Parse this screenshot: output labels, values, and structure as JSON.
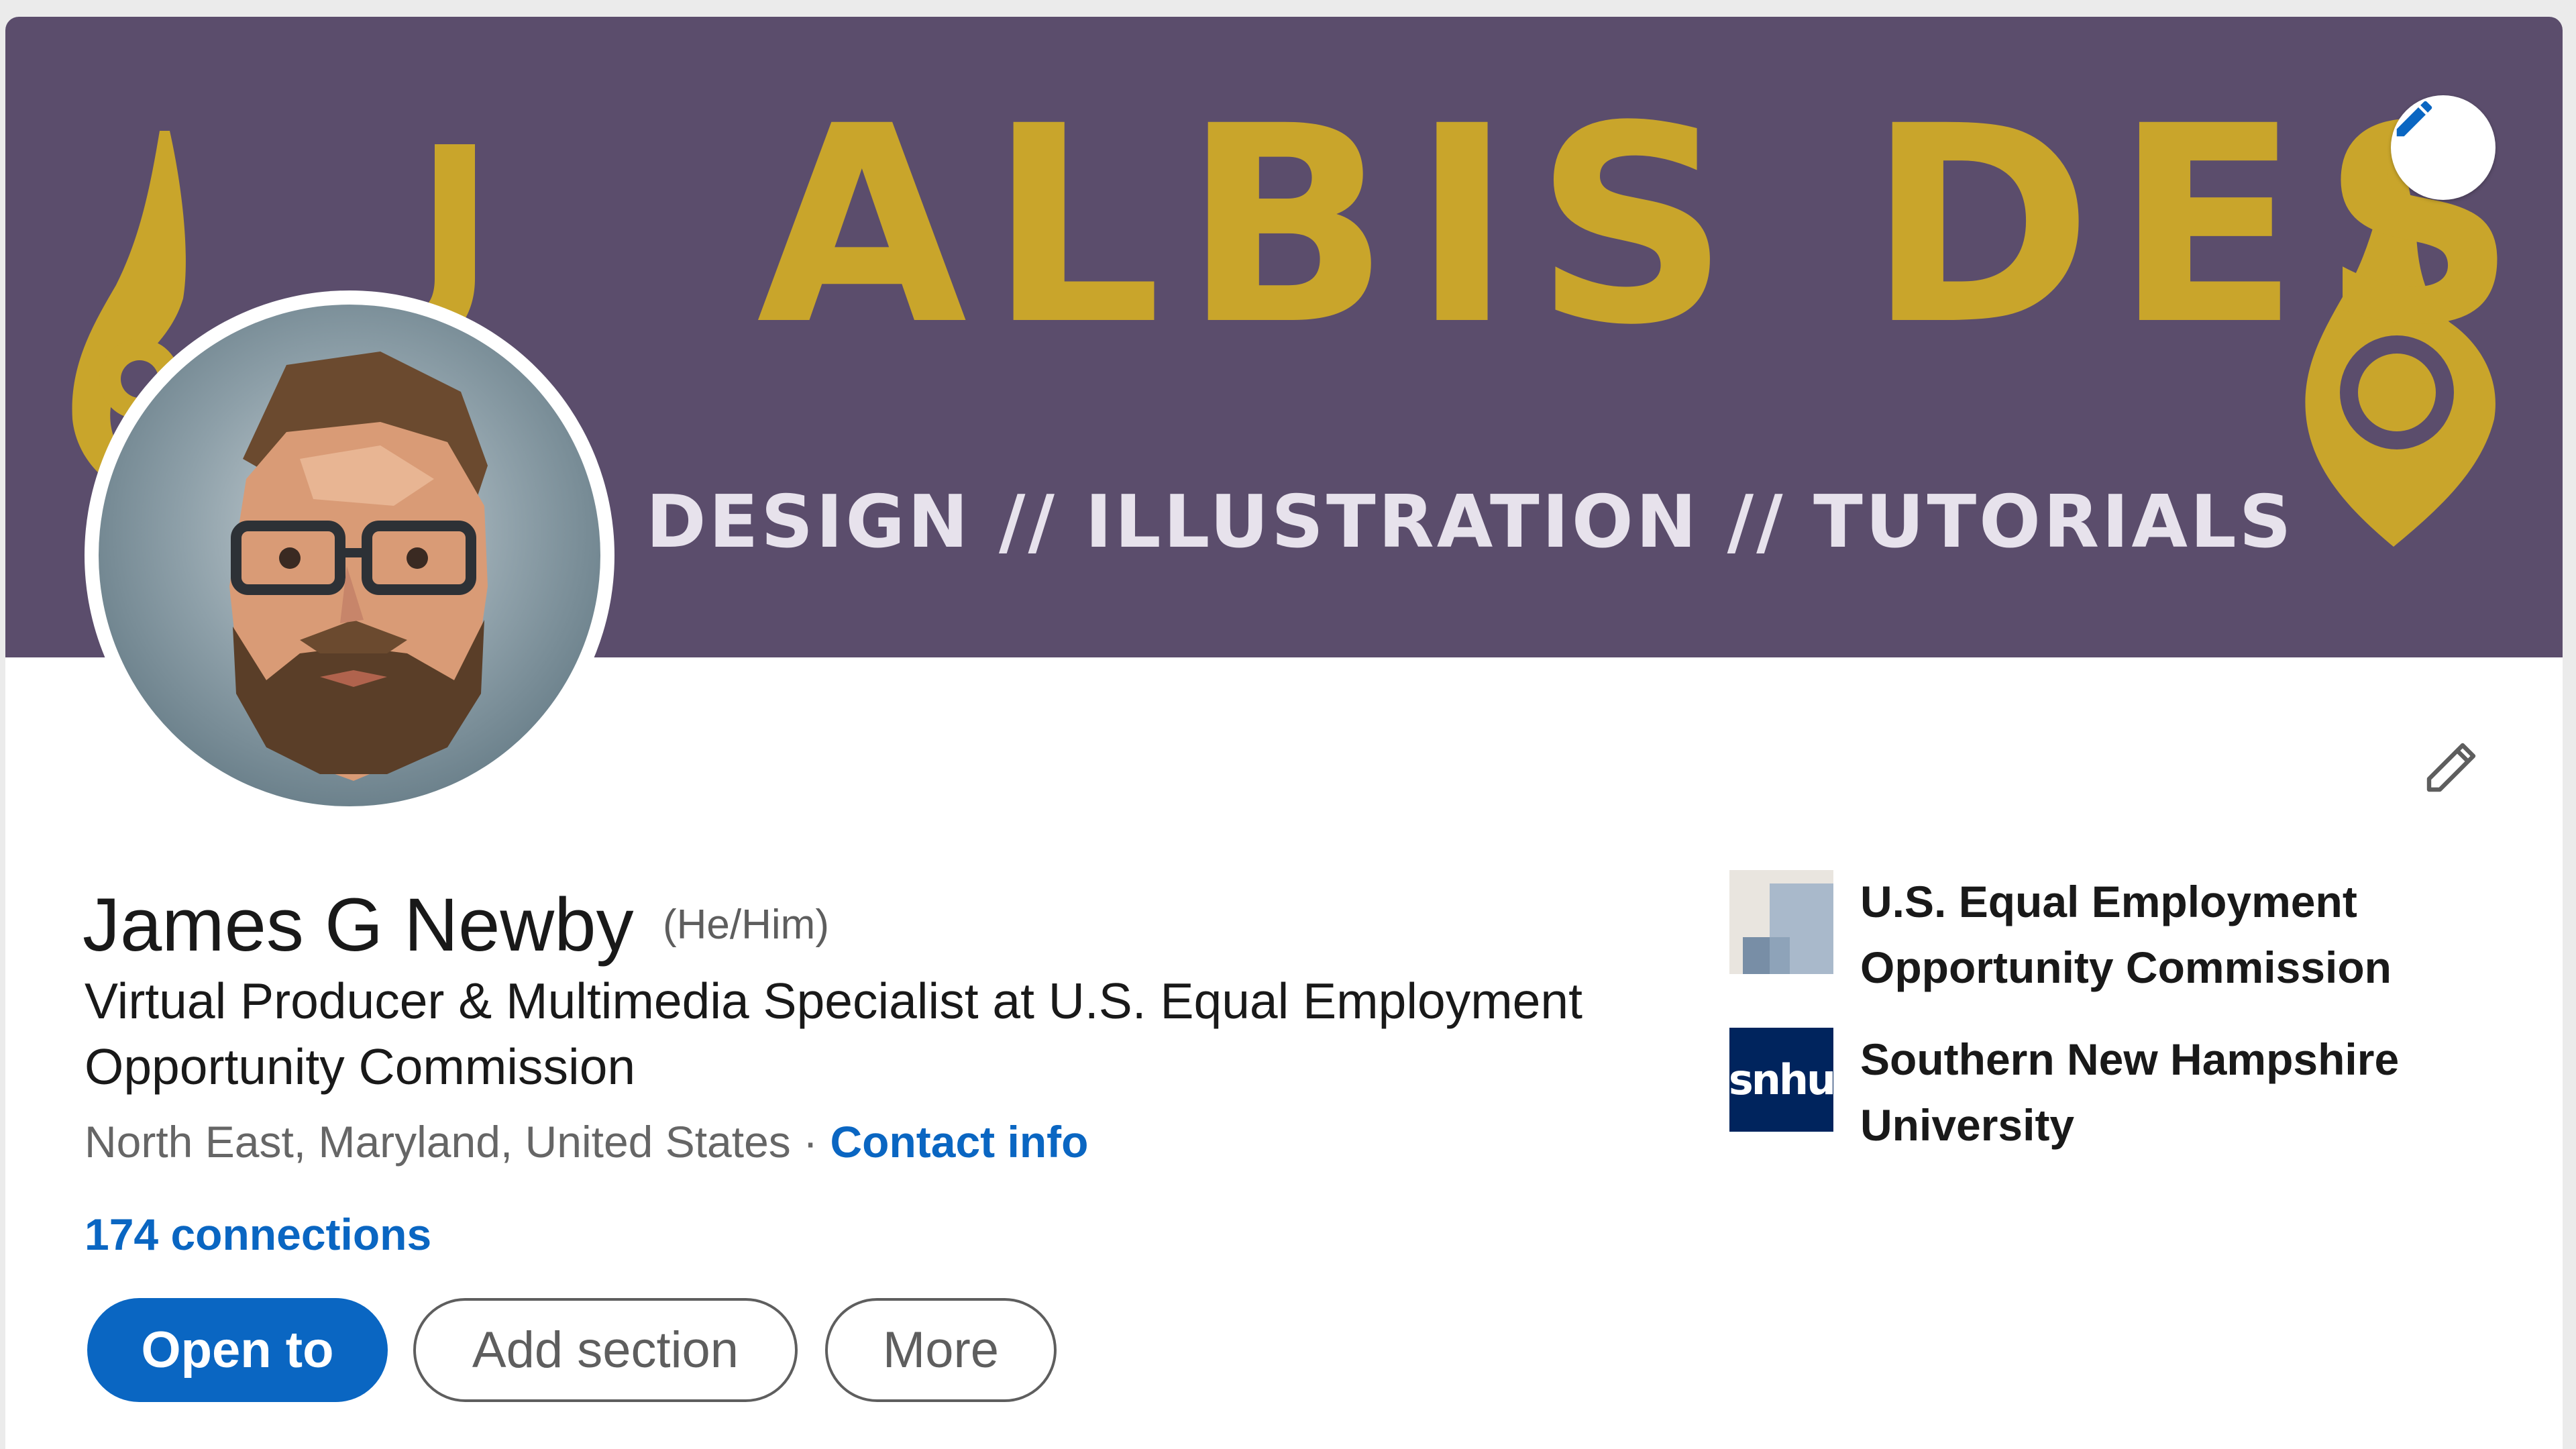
{
  "banner": {
    "title": "ALBIS DESIGN",
    "subtitle": "DESIGN // ILLUSTRATION // TUTORIALS",
    "background_color": "#5b4d6c",
    "accent_color": "#c9a52b",
    "edit_icon": "pencil-icon"
  },
  "profile": {
    "name": "James G Newby",
    "pronouns": "(He/Him)",
    "headline": "Virtual Producer & Multimedia Specialist at U.S. Equal Employment Opportunity Commission",
    "location": "North East, Maryland, United States",
    "separator": "·",
    "contact_label": "Contact info",
    "connections": "174 connections",
    "edit_icon": "pencil-icon"
  },
  "actions": {
    "open_to": "Open to",
    "add_section": "Add section",
    "more": "More",
    "primary_color": "#0a66c2"
  },
  "organizations": [
    {
      "name": "U.S. Equal Employment Opportunity Commission",
      "logo_icon": "company-logo-placeholder-icon"
    },
    {
      "name": "Southern New Hampshire University",
      "logo_text": "snhu",
      "logo_color": "#00245d"
    }
  ]
}
